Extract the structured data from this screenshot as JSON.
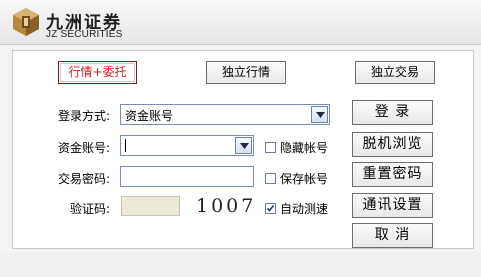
{
  "brand": {
    "cn": "九洲证券",
    "en": "JZ SECURITIES",
    "logo_colors": [
      "#b8863b",
      "#6b4a1f",
      "#d8b271"
    ]
  },
  "mode_buttons": [
    {
      "label": "行情+委托",
      "active": true
    },
    {
      "label": "独立行情",
      "active": false
    },
    {
      "label": "独立交易",
      "active": false
    }
  ],
  "form": {
    "login_type": {
      "label": "登录方式:",
      "value": "资金账号"
    },
    "account": {
      "label": "资金账号:",
      "value": ""
    },
    "password": {
      "label": "交易密码:",
      "value": ""
    },
    "captcha": {
      "label": "验证码:",
      "value": "",
      "code": "1007"
    }
  },
  "checkboxes": {
    "hide_account": {
      "label": "隐藏帐号",
      "checked": false
    },
    "save_account": {
      "label": "保存帐号",
      "checked": false
    },
    "auto_speedtest": {
      "label": "自动测速",
      "checked": true
    }
  },
  "side_buttons": {
    "login": "登  录",
    "offline": "脱机浏览",
    "reset_password": "重置密码",
    "network": "通讯设置",
    "cancel": "取  消"
  },
  "colors": {
    "active_mode_text": "#d31c1c",
    "field_border": "#7a8fb0"
  }
}
